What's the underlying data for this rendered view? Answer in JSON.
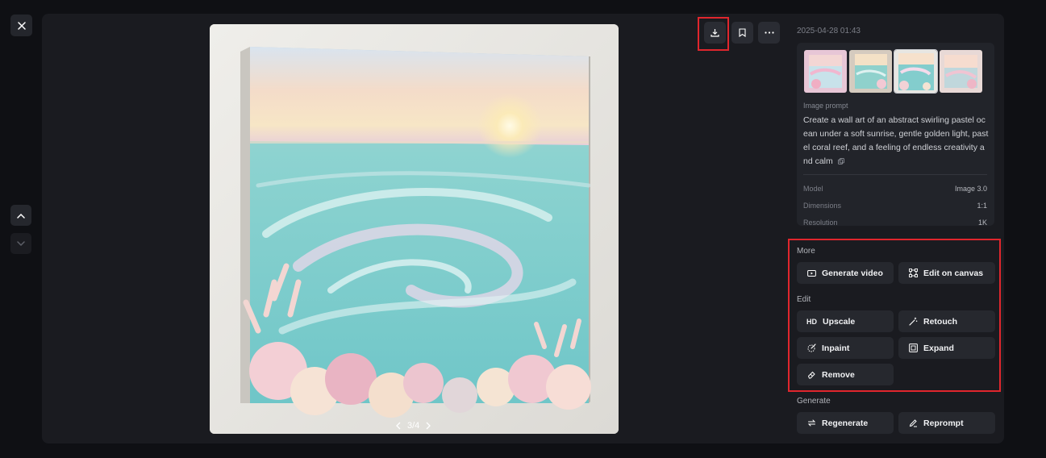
{
  "header": {
    "date": "2025-04-28 01:43"
  },
  "pager": {
    "label": "3/4"
  },
  "prompt": {
    "label": "Image prompt",
    "text": "Create a wall art of an abstract swirling pastel ocean under a soft sunrise, gentle golden light, pastel coral reef, and a feeling of endless creativity and calm"
  },
  "meta": [
    {
      "key": "Model",
      "value": "Image 3.0"
    },
    {
      "key": "Dimensions",
      "value": "1:1"
    },
    {
      "key": "Resolution",
      "value": "1K"
    }
  ],
  "sections": {
    "more": "More",
    "edit": "Edit",
    "generate": "Generate"
  },
  "actions": {
    "generate_video": "Generate video",
    "edit_on_canvas": "Edit on canvas",
    "upscale": "Upscale",
    "upscale_badge": "HD",
    "retouch": "Retouch",
    "inpaint": "Inpaint",
    "expand": "Expand",
    "remove": "Remove",
    "regenerate": "Regenerate",
    "reprompt": "Reprompt"
  },
  "icons": [
    "close-icon",
    "chevron-up-icon",
    "chevron-down-icon",
    "download-icon",
    "bookmark-icon",
    "more-icon",
    "copy-icon",
    "video-icon",
    "canvas-icon",
    "retouch-icon",
    "inpaint-icon",
    "expand-icon",
    "eraser-icon",
    "regenerate-icon",
    "pencil-icon",
    "chevron-left-icon",
    "chevron-right-icon"
  ],
  "colors": {
    "background": "#0f1014",
    "panel": "#1a1b20",
    "highlight": "#e0262d",
    "button": "#26282e"
  }
}
